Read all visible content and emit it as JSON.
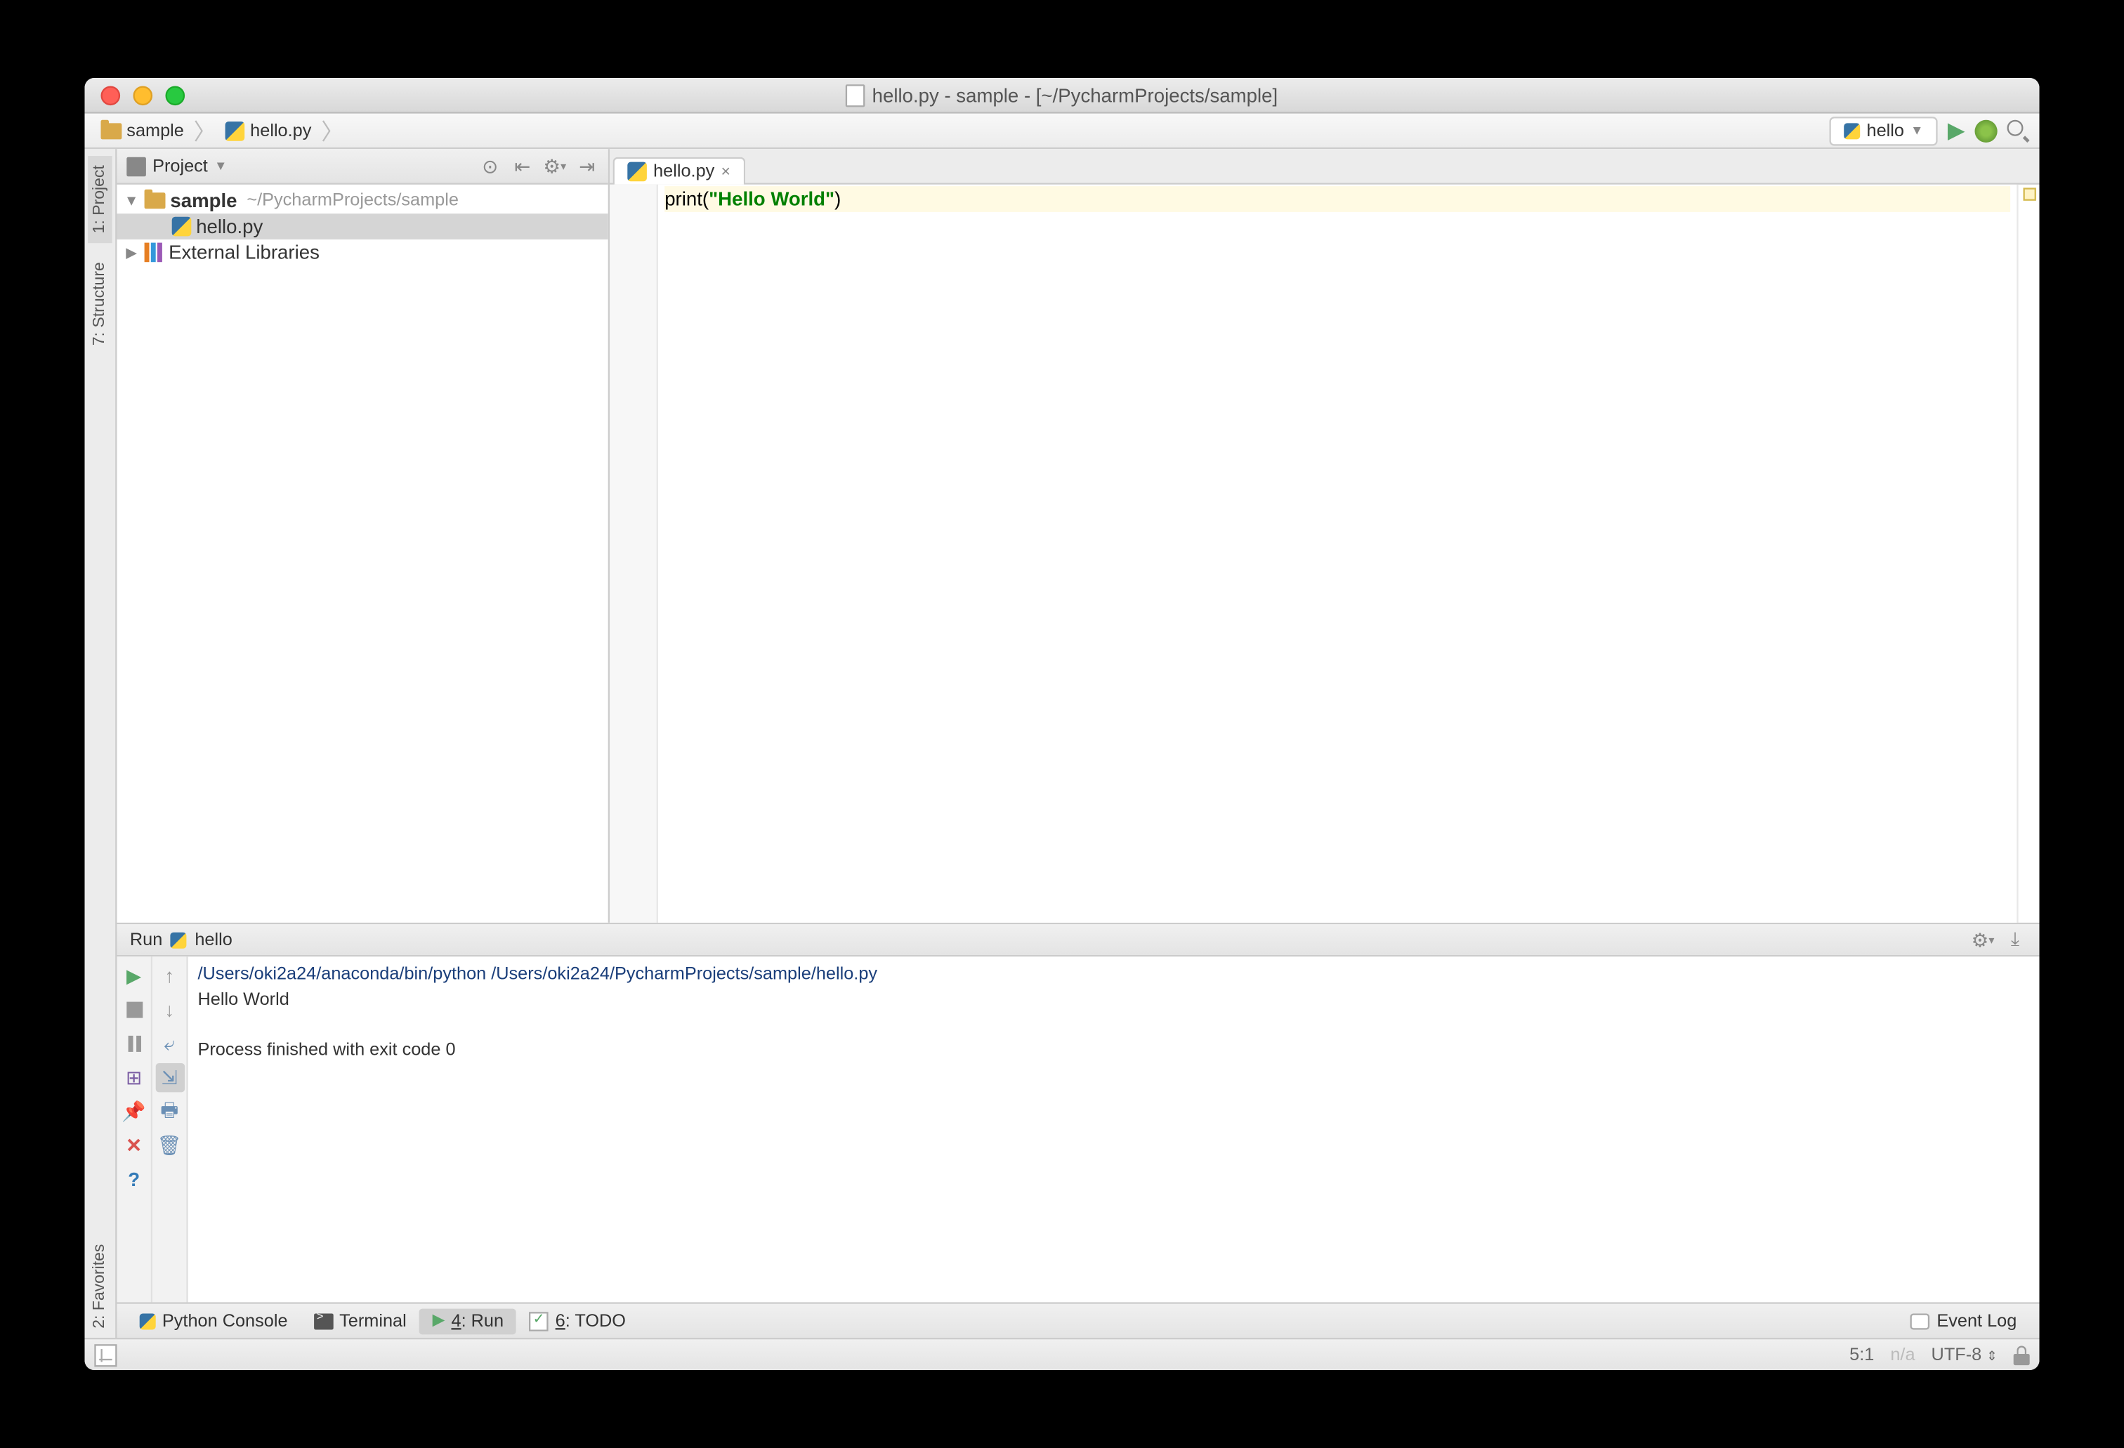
{
  "window": {
    "title": "hello.py - sample - [~/PycharmProjects/sample]"
  },
  "breadcrumb": {
    "project": "sample",
    "file": "hello.py"
  },
  "runConfig": {
    "name": "hello"
  },
  "leftGutter": {
    "project": "1: Project",
    "structure": "7: Structure",
    "favorites": "2: Favorites"
  },
  "projectPanel": {
    "title": "Project",
    "tree": {
      "root": {
        "name": "sample",
        "path": "~/PycharmProjects/sample"
      },
      "file": "hello.py",
      "extlib": "External Libraries"
    }
  },
  "editor": {
    "tab": "hello.py",
    "code": {
      "fn": "print",
      "lparen": "(",
      "str": "\"Hello World\"",
      "rparen": ")"
    }
  },
  "run": {
    "title": "Run",
    "config": "hello",
    "cmd": "/Users/oki2a24/anaconda/bin/python /Users/oki2a24/PycharmProjects/sample/hello.py",
    "out": "Hello World",
    "exit": "Process finished with exit code 0"
  },
  "bottomTabs": {
    "pyconsole": "Python Console",
    "terminal": "Terminal",
    "run": "4: Run",
    "todo": "6: TODO",
    "eventlog": "Event Log"
  },
  "status": {
    "pos": "5:1",
    "insert": "n/a",
    "encoding": "UTF-8"
  }
}
